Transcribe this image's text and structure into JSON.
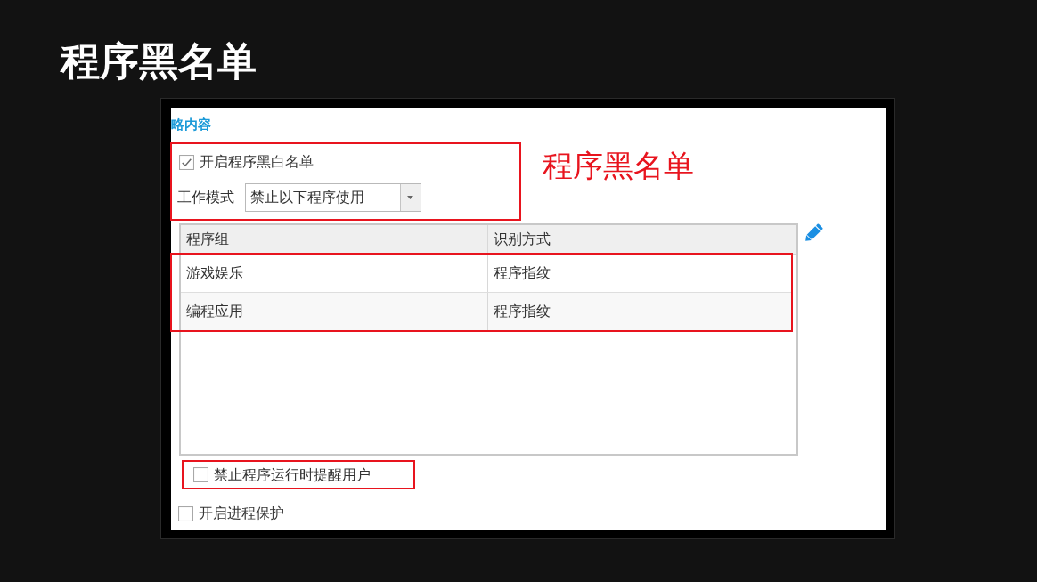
{
  "slide_title": "程序黑名单",
  "screenshot": {
    "section_heading": "略内容",
    "blacklist_group": {
      "highlighted": true,
      "enable_checkbox": {
        "label": "开启程序黑白名单",
        "checked": true
      },
      "work_mode": {
        "label": "工作模式",
        "value": "禁止以下程序使用"
      }
    },
    "callout": "程序黑名单",
    "program_table": {
      "columns": [
        "程序组",
        "识别方式"
      ],
      "rows_highlighted": true,
      "rows": [
        [
          "游戏娱乐",
          "程序指纹"
        ],
        [
          "编程应用",
          "程序指纹"
        ]
      ]
    },
    "options": [
      {
        "label": "禁止程序运行时提醒用户",
        "checked": false,
        "highlighted": true
      },
      {
        "label": "开启进程保护",
        "checked": false,
        "highlighted": false
      }
    ]
  }
}
